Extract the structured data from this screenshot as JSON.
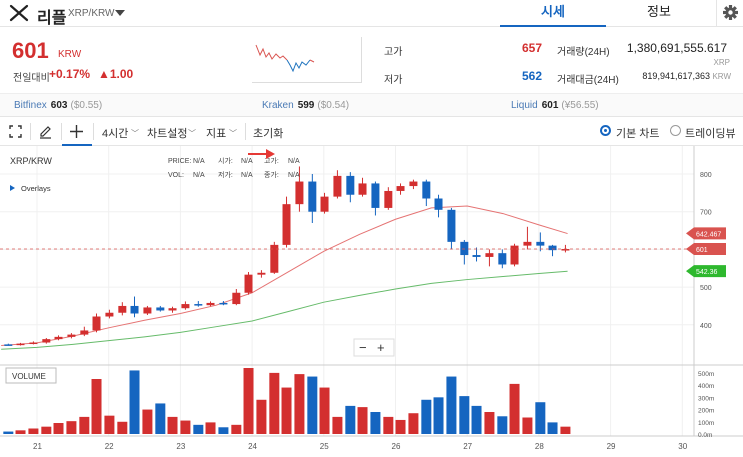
{
  "header": {
    "coin_name": "리플",
    "pair": "XRP/KRW",
    "tab_price": "시세",
    "tab_info": "정보"
  },
  "summary": {
    "price": "601",
    "currency": "KRW",
    "change_label": "전일대비",
    "change_pct": "+0.17%",
    "change_abs": "▲1.00",
    "high_label": "고가",
    "high_value": "657",
    "low_label": "저가",
    "low_value": "562",
    "vol_label": "거래량(24H)",
    "vol_value": "1,380,691,555.617",
    "vol_unit": "XRP",
    "amt_label": "거래대금(24H)",
    "amt_value": "819,941,617,363",
    "amt_unit": "KRW",
    "colors": {
      "up": "#d32f2f",
      "down": "#1565c0"
    }
  },
  "exchanges": [
    {
      "name": "Bitfinex",
      "value": "603",
      "sub": "($0.55)"
    },
    {
      "name": "Kraken",
      "value": "599",
      "sub": "($0.54)"
    },
    {
      "name": "Liquid",
      "value": "601",
      "sub": "(¥56.55)"
    }
  ],
  "toolbar": {
    "interval": "4시간",
    "chart_settings": "차트설정",
    "indicators": "지표",
    "reset": "초기화",
    "basic_chart": "기본 차트",
    "tradingview": "트레이딩뷰"
  },
  "chart": {
    "symbol": "XRP/KRW",
    "overlays": "Overlays",
    "volume_label": "VOLUME",
    "ohlc": {
      "price_label": "PRICE:",
      "price": "N/A",
      "open_label": "시가:",
      "open": "N/A",
      "high_label": "고가:",
      "high": "N/A",
      "vol_label": "VOL:",
      "vol": "N/A",
      "close_label": "종가:",
      "close": "N/A",
      "low_label": "저가:",
      "low": "N/A"
    },
    "zoom_out": "−",
    "zoom_in": "+"
  },
  "chart_data": {
    "type": "candlestick",
    "x_ticks": [
      "21",
      "22",
      "23",
      "24",
      "25",
      "26",
      "27",
      "28",
      "29",
      "30"
    ],
    "y_ticks": [
      "400",
      "500",
      "600",
      "700",
      "800"
    ],
    "ylim": [
      330,
      830
    ],
    "volume_ticks": [
      "500m",
      "400m",
      "300m",
      "200m",
      "100m",
      "0.0m"
    ],
    "volume_ylim": [
      0,
      540
    ],
    "price_marks": [
      {
        "label": "642.467",
        "value": 642.467,
        "color": "#d9534f"
      },
      {
        "label": "601",
        "value": 601,
        "color": "#d9534f"
      },
      {
        "label": "542.36",
        "value": 542.36,
        "color": "#2eb82e"
      }
    ],
    "candles": [
      {
        "x": 20.6,
        "o": 348,
        "h": 350,
        "l": 345,
        "c": 347,
        "v": 20
      },
      {
        "x": 20.77,
        "o": 347,
        "h": 352,
        "l": 345,
        "c": 350,
        "v": 30
      },
      {
        "x": 20.95,
        "o": 350,
        "h": 356,
        "l": 348,
        "c": 353,
        "v": 45
      },
      {
        "x": 21.13,
        "o": 353,
        "h": 365,
        "l": 350,
        "c": 362,
        "v": 60
      },
      {
        "x": 21.3,
        "o": 362,
        "h": 372,
        "l": 359,
        "c": 368,
        "v": 90
      },
      {
        "x": 21.48,
        "o": 368,
        "h": 378,
        "l": 364,
        "c": 374,
        "v": 105
      },
      {
        "x": 21.66,
        "o": 374,
        "h": 395,
        "l": 370,
        "c": 385,
        "v": 140
      },
      {
        "x": 21.83,
        "o": 385,
        "h": 430,
        "l": 380,
        "c": 422,
        "v": 450
      },
      {
        "x": 22.01,
        "o": 422,
        "h": 440,
        "l": 417,
        "c": 432,
        "v": 150
      },
      {
        "x": 22.19,
        "o": 432,
        "h": 460,
        "l": 425,
        "c": 450,
        "v": 100
      },
      {
        "x": 22.36,
        "o": 450,
        "h": 475,
        "l": 420,
        "c": 430,
        "v": 520
      },
      {
        "x": 22.54,
        "o": 430,
        "h": 450,
        "l": 426,
        "c": 446,
        "v": 200
      },
      {
        "x": 22.72,
        "o": 446,
        "h": 450,
        "l": 435,
        "c": 438,
        "v": 250
      },
      {
        "x": 22.89,
        "o": 438,
        "h": 448,
        "l": 432,
        "c": 444,
        "v": 140
      },
      {
        "x": 23.07,
        "o": 444,
        "h": 462,
        "l": 440,
        "c": 455,
        "v": 110
      },
      {
        "x": 23.25,
        "o": 455,
        "h": 463,
        "l": 448,
        "c": 452,
        "v": 75
      },
      {
        "x": 23.42,
        "o": 452,
        "h": 462,
        "l": 449,
        "c": 458,
        "v": 95
      },
      {
        "x": 23.6,
        "o": 458,
        "h": 463,
        "l": 452,
        "c": 455,
        "v": 55
      },
      {
        "x": 23.78,
        "o": 455,
        "h": 495,
        "l": 452,
        "c": 485,
        "v": 75
      },
      {
        "x": 23.95,
        "o": 485,
        "h": 540,
        "l": 480,
        "c": 533,
        "v": 540
      },
      {
        "x": 24.13,
        "o": 533,
        "h": 545,
        "l": 525,
        "c": 538,
        "v": 280
      },
      {
        "x": 24.31,
        "o": 538,
        "h": 620,
        "l": 535,
        "c": 612,
        "v": 500
      },
      {
        "x": 24.48,
        "o": 612,
        "h": 740,
        "l": 605,
        "c": 720,
        "v": 380
      },
      {
        "x": 24.66,
        "o": 720,
        "h": 820,
        "l": 700,
        "c": 780,
        "v": 490
      },
      {
        "x": 24.84,
        "o": 780,
        "h": 800,
        "l": 670,
        "c": 700,
        "v": 470
      },
      {
        "x": 25.01,
        "o": 700,
        "h": 750,
        "l": 695,
        "c": 740,
        "v": 380
      },
      {
        "x": 25.19,
        "o": 740,
        "h": 810,
        "l": 735,
        "c": 795,
        "v": 140
      },
      {
        "x": 25.37,
        "o": 795,
        "h": 805,
        "l": 725,
        "c": 745,
        "v": 230
      },
      {
        "x": 25.54,
        "o": 745,
        "h": 790,
        "l": 740,
        "c": 775,
        "v": 220
      },
      {
        "x": 25.72,
        "o": 775,
        "h": 780,
        "l": 690,
        "c": 710,
        "v": 180
      },
      {
        "x": 25.9,
        "o": 710,
        "h": 765,
        "l": 705,
        "c": 755,
        "v": 140
      },
      {
        "x": 26.07,
        "o": 755,
        "h": 775,
        "l": 745,
        "c": 768,
        "v": 115
      },
      {
        "x": 26.25,
        "o": 768,
        "h": 785,
        "l": 760,
        "c": 780,
        "v": 170
      },
      {
        "x": 26.43,
        "o": 780,
        "h": 785,
        "l": 715,
        "c": 735,
        "v": 280
      },
      {
        "x": 26.6,
        "o": 735,
        "h": 745,
        "l": 685,
        "c": 705,
        "v": 300
      },
      {
        "x": 26.78,
        "o": 705,
        "h": 710,
        "l": 600,
        "c": 620,
        "v": 470
      },
      {
        "x": 26.96,
        "o": 620,
        "h": 625,
        "l": 560,
        "c": 585,
        "v": 310
      },
      {
        "x": 27.13,
        "o": 585,
        "h": 605,
        "l": 568,
        "c": 580,
        "v": 230
      },
      {
        "x": 27.31,
        "o": 580,
        "h": 600,
        "l": 555,
        "c": 590,
        "v": 180
      },
      {
        "x": 27.49,
        "o": 590,
        "h": 600,
        "l": 550,
        "c": 560,
        "v": 145
      },
      {
        "x": 27.66,
        "o": 560,
        "h": 615,
        "l": 555,
        "c": 610,
        "v": 410
      },
      {
        "x": 27.84,
        "o": 610,
        "h": 660,
        "l": 600,
        "c": 620,
        "v": 135
      },
      {
        "x": 28.02,
        "o": 620,
        "h": 645,
        "l": 595,
        "c": 610,
        "v": 260
      },
      {
        "x": 28.19,
        "o": 610,
        "h": 612,
        "l": 582,
        "c": 598,
        "v": 95
      },
      {
        "x": 28.37,
        "o": 598,
        "h": 612,
        "l": 592,
        "c": 601,
        "v": 60
      }
    ],
    "ma_short": [
      [
        20.5,
        345
      ],
      [
        21,
        352
      ],
      [
        21.5,
        370
      ],
      [
        22,
        392
      ],
      [
        22.5,
        412
      ],
      [
        23,
        430
      ],
      [
        23.5,
        452
      ],
      [
        24,
        485
      ],
      [
        24.5,
        540
      ],
      [
        25,
        595
      ],
      [
        25.5,
        640
      ],
      [
        26,
        680
      ],
      [
        26.5,
        710
      ],
      [
        27,
        715
      ],
      [
        27.5,
        695
      ],
      [
        28,
        665
      ],
      [
        28.4,
        642
      ]
    ],
    "ma_long": [
      [
        20.5,
        335
      ],
      [
        21,
        340
      ],
      [
        21.5,
        348
      ],
      [
        22,
        358
      ],
      [
        22.5,
        368
      ],
      [
        23,
        380
      ],
      [
        23.5,
        395
      ],
      [
        24,
        410
      ],
      [
        24.5,
        435
      ],
      [
        25,
        460
      ],
      [
        25.5,
        478
      ],
      [
        26,
        495
      ],
      [
        26.5,
        510
      ],
      [
        27,
        520
      ],
      [
        27.5,
        528
      ],
      [
        28,
        536
      ],
      [
        28.4,
        542
      ]
    ]
  }
}
